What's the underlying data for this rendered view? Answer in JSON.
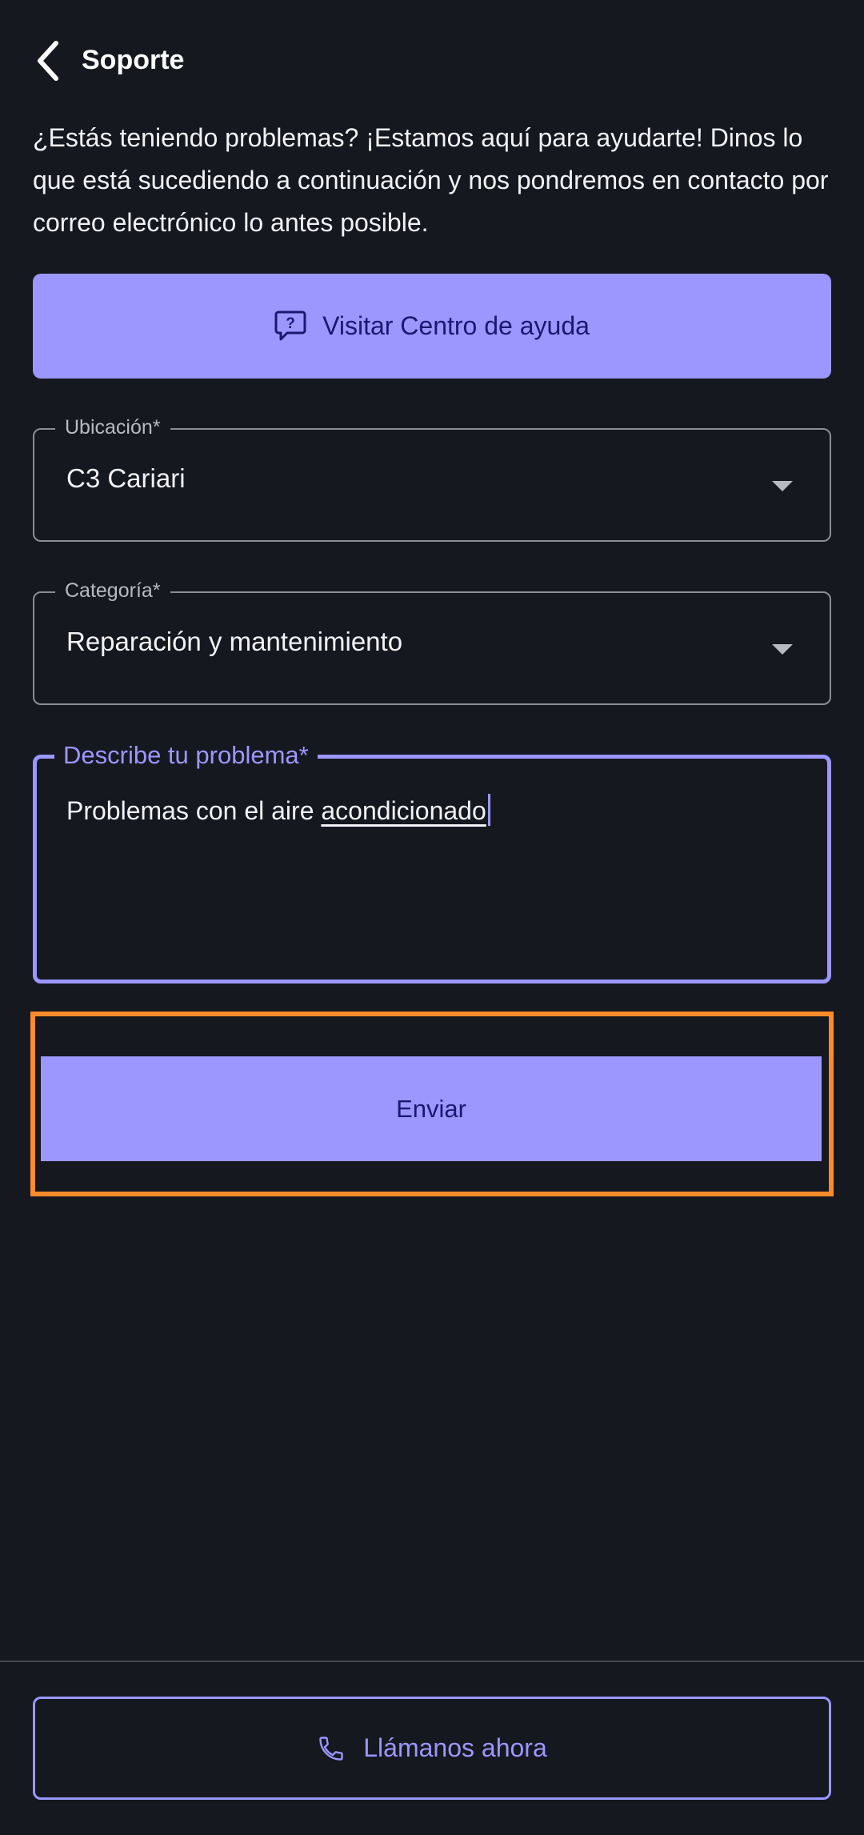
{
  "header": {
    "title": "Soporte",
    "back_icon": "chevron-left-icon"
  },
  "intro_text": "¿Estás teniendo problemas? ¡Estamos aquí para ayudarte! Dinos lo que está sucediendo a continuación y nos pondremos en contacto por correo electrónico lo antes posible.",
  "help_center": {
    "label": "Visitar Centro de ayuda",
    "icon": "question-chat-icon"
  },
  "form": {
    "location": {
      "label": "Ubicación*",
      "value": "C3 Cariari"
    },
    "category": {
      "label": "Categoría*",
      "value": "Reparación y mantenimiento"
    },
    "description": {
      "label": "Describe tu problema*",
      "value_prefix": "Problemas con el aire ",
      "value_underlined": "acondicionado"
    },
    "submit_label": "Enviar"
  },
  "call": {
    "label": "Llámanos ahora",
    "icon": "phone-icon"
  },
  "colors": {
    "background": "#161820",
    "accent": "#9b97ff",
    "accent_text": "#1a1970",
    "highlight": "#ff8a2a"
  }
}
